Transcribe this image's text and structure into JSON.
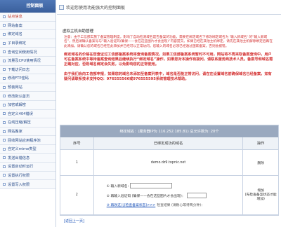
{
  "sidebar": {
    "header": "控制面板",
    "items": [
      "站点信息",
      "网站备案",
      "绑定域名",
      "子目录绑定",
      "查询空间使用情况",
      "流量及CPU使用情况",
      "下载访问日志",
      "修改FTP密码",
      "预装网站",
      "修改默认首页",
      "加密或解密",
      "自定义404错误",
      "在线压缩/解压",
      "网站搬家",
      "回收网站应用程序池",
      "自定义mime类型",
      "发送出错信息",
      "设置启动时运行",
      "设置执行权限",
      "设置写入权限"
    ]
  },
  "topbar": {
    "title": "欢迎您使用功能强大的控制面板"
  },
  "main": {
    "section_title": "虚拟主机自助管理",
    "notice_red": "注意：由于工信部实施了备案管理制度，影响了自动检测域名是否备案的功能。需要在绑定域名下修改绑定域名为 '输入新域名' 的“输入新域名”，然后请确认备案号与“输入验证码(确保——会在这些图片才会出现)”内容提交。如果已经在其他主机绑定，请先在其他主机解除绑定后再在此添加。请确认您的域名已经在此添加并已经可以正常访问。您输入的域名必须已经通过国家备案，否则会报错。",
    "notice_bold1": "绑定域名的价格在您查证过工信部备案系统将查询备案情况，如果工信部备案系统暂时不可用，网站将不再采取备案查询中，用户可在备案系统中等待备案查询结果后继续执行“绑定域名”操作，如果您对本操作有疑问，请联系服务商技术人员。备案号和域名需正确对应，否则域名绑定会失败，以免影响您的正常使用。",
    "notice_bold2": "由于我们会向工信部申报，如果您的域名未添加至备案列表中，域名是否能正常访问，请在在设置域名前确保域名已经备案，如有疑问请联系技术支持QQ：976555566或976555595系统管理技术帮助。",
    "table": {
      "header": "绑定域名：(服务器IP为 116.252.185.81) 总允许数为: 20个",
      "columns": [
        "序号",
        "已绑定成功的域名",
        "操作"
      ],
      "rows": [
        {
          "index": "1",
          "domain": "demo.dz9.topnic.net",
          "action": "删除"
        }
      ],
      "add_row": {
        "index": "2",
        "step1_label": "① 输入新域名:",
        "step2_label": "② 再输入验证码 (确保——会在这些图片才会出现)：",
        "step3_link": "③ 再改这儿(检查备案状态)>>>",
        "step3_check_label": "检查结果 (请耐心等待两分钟)：",
        "action_add": "增加",
        "action_note": "(先检查备案状态才能增加)"
      }
    },
    "back_link": "[返回上一页]"
  }
}
